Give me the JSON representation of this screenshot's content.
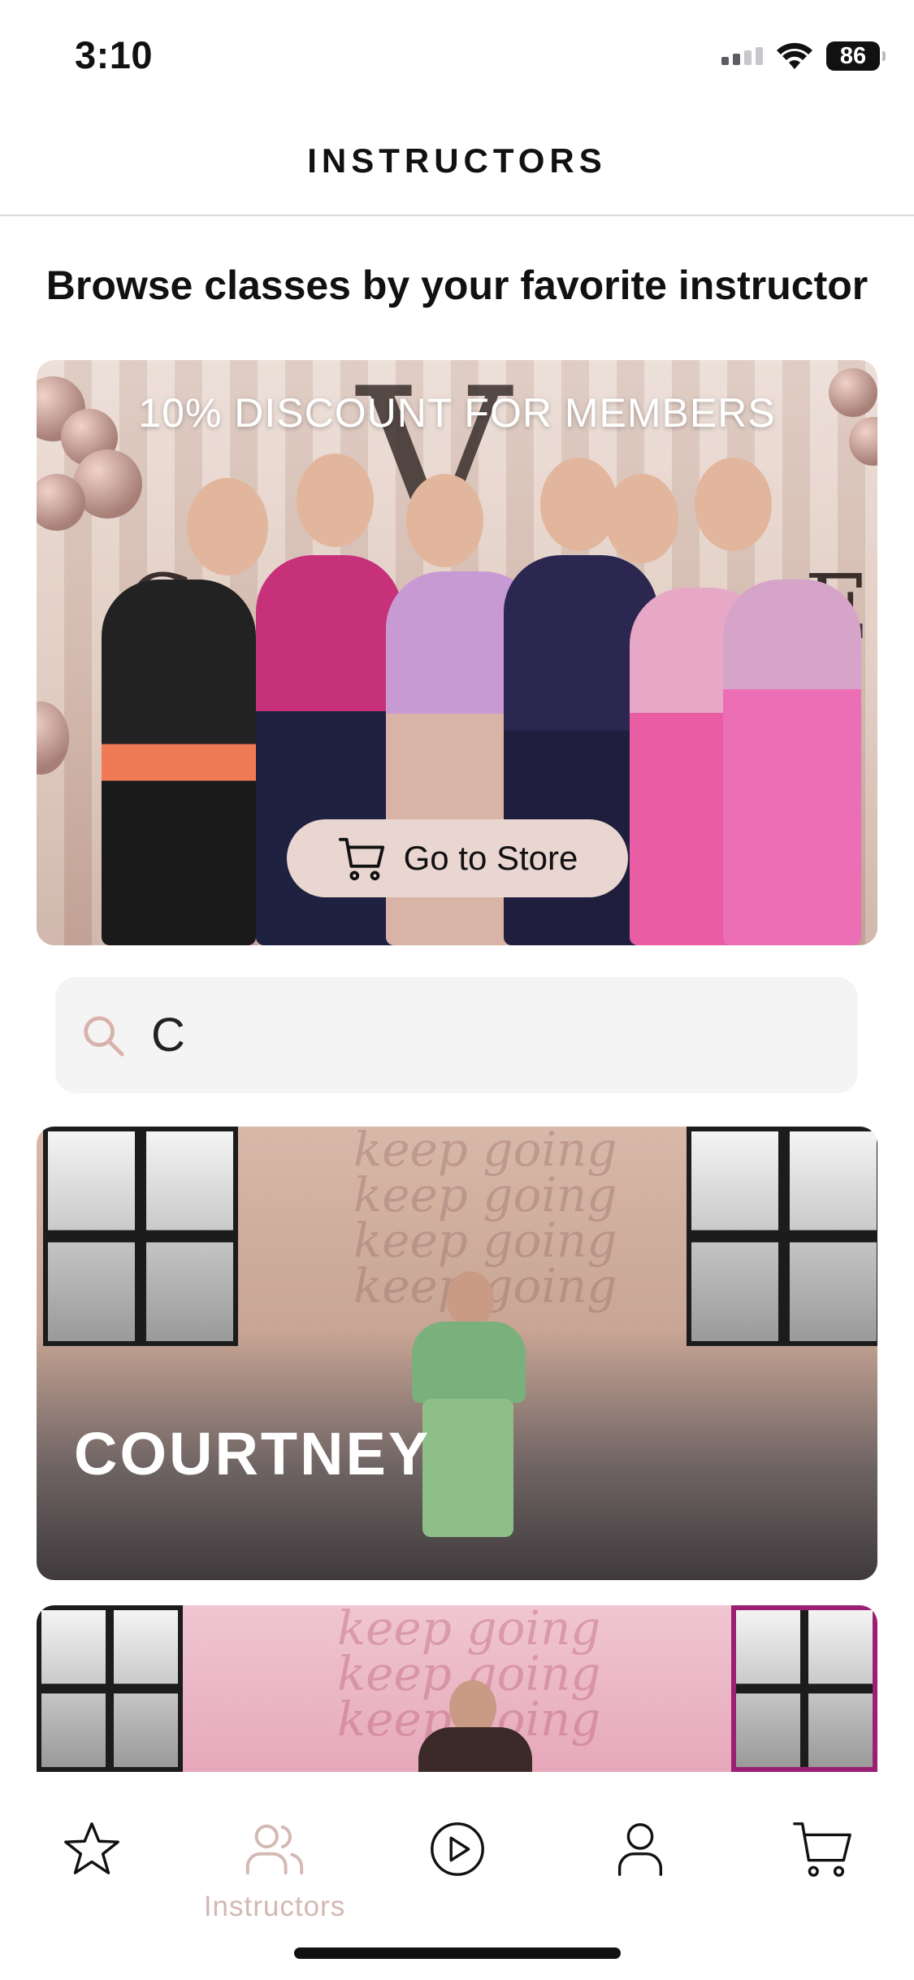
{
  "status_bar": {
    "time": "3:10",
    "battery": "86"
  },
  "header": {
    "title": "INSTRUCTORS"
  },
  "page": {
    "heading": "Browse classes by your favorite instructor"
  },
  "banner": {
    "promo_text": "10% DISCOUNT FOR MEMBERS",
    "store_button_label": "Go to Store"
  },
  "search": {
    "value": "C"
  },
  "instructors": [
    {
      "name": "COURTNEY"
    }
  ],
  "tab_bar": {
    "active_label": "Instructors",
    "tabs": [
      {
        "icon": "star-icon"
      },
      {
        "icon": "users-icon",
        "label": "Instructors"
      },
      {
        "icon": "play-circle-icon"
      },
      {
        "icon": "profile-icon"
      },
      {
        "icon": "cart-icon"
      }
    ]
  },
  "colors": {
    "accent": "#d3b8b3",
    "button_bg": "#ead6d1",
    "search_bg": "#f4f4f4"
  }
}
